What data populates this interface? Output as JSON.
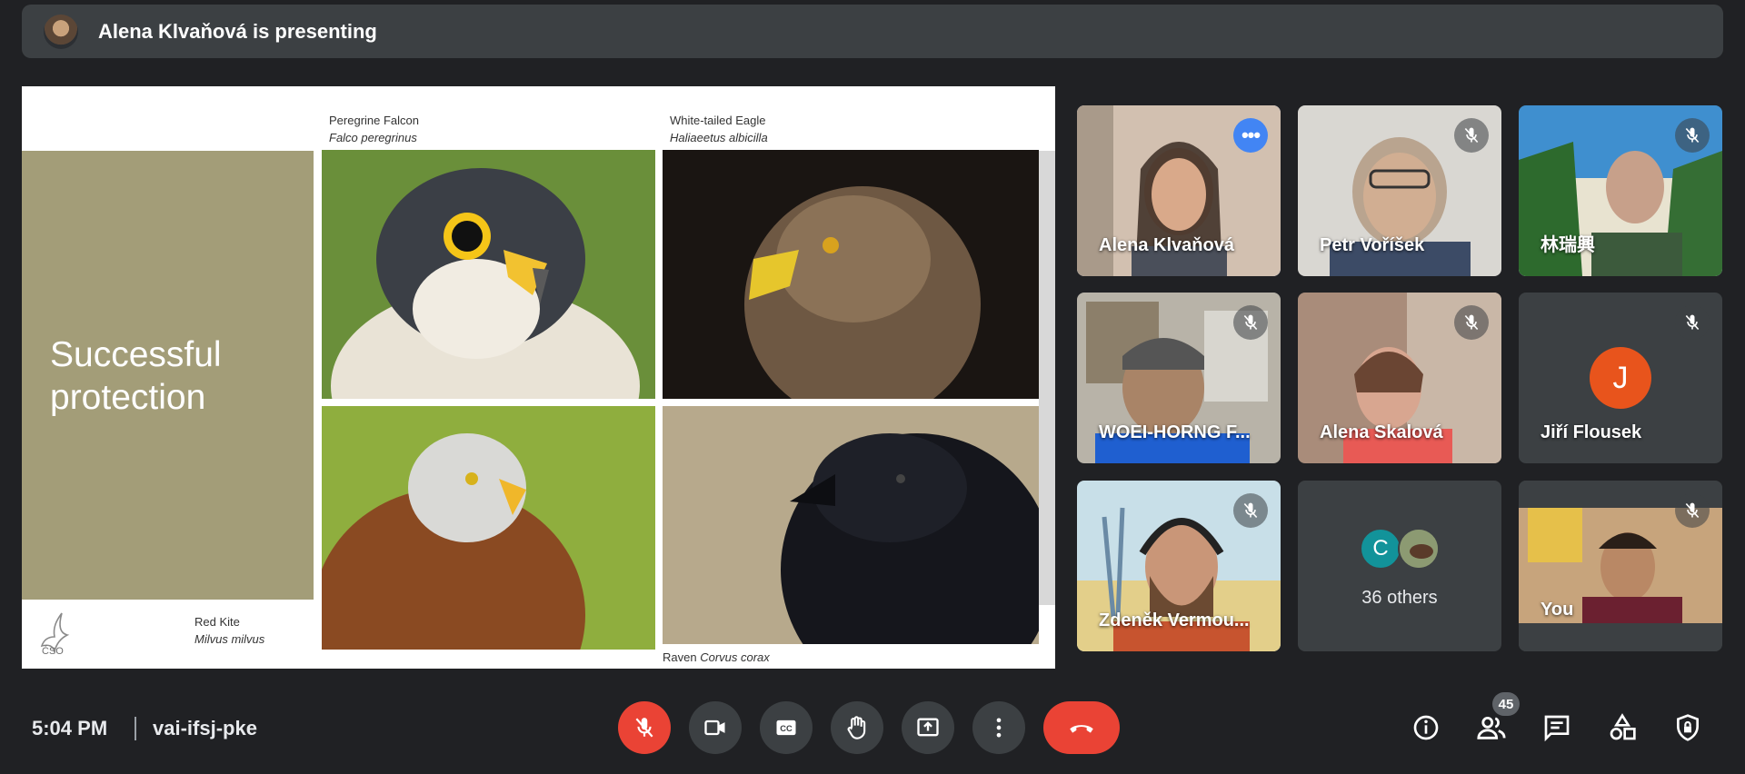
{
  "presenting": {
    "text": "Alena Klvaňová is presenting"
  },
  "slide": {
    "title_line1": "Successful",
    "title_line2": "protection",
    "logo_text": "ČSO",
    "birds": [
      {
        "common": "Peregrine Falcon",
        "latin": "Falco peregrinus"
      },
      {
        "common": "White-tailed Eagle",
        "latin": "Haliaeetus albicilla"
      },
      {
        "common": "Red Kite",
        "latin": "Milvus milvus"
      },
      {
        "common": "Raven",
        "latin": "Corvus corax"
      }
    ]
  },
  "participants": [
    {
      "name": "Alena Klvaňová",
      "speaking": true
    },
    {
      "name": "Petr Voříšek",
      "muted": true
    },
    {
      "name": "林瑞興",
      "muted": true
    },
    {
      "name": "WOEI-HORNG F...",
      "muted": true
    },
    {
      "name": "Alena Skalová",
      "muted": true
    },
    {
      "name": "Jiří Flousek",
      "muted": true,
      "initial": "J"
    },
    {
      "name": "Zdeněk Vermou...",
      "muted": true
    },
    {
      "others_label": "36 others",
      "avatar_initial": "C"
    },
    {
      "name": "You",
      "muted": true
    }
  ],
  "bottom_bar": {
    "time": "5:04 PM",
    "meeting_code": "vai-ifsj-pke",
    "people_count": "45",
    "accent_red": "#ea4335",
    "button_gray": "#3c4043"
  },
  "icons": [
    "mic-off-icon",
    "camera-icon",
    "captions-icon",
    "raise-hand-icon",
    "present-icon",
    "more-vert-icon",
    "hang-up-icon",
    "info-icon",
    "people-icon",
    "chat-icon",
    "activities-icon",
    "host-controls-icon"
  ]
}
